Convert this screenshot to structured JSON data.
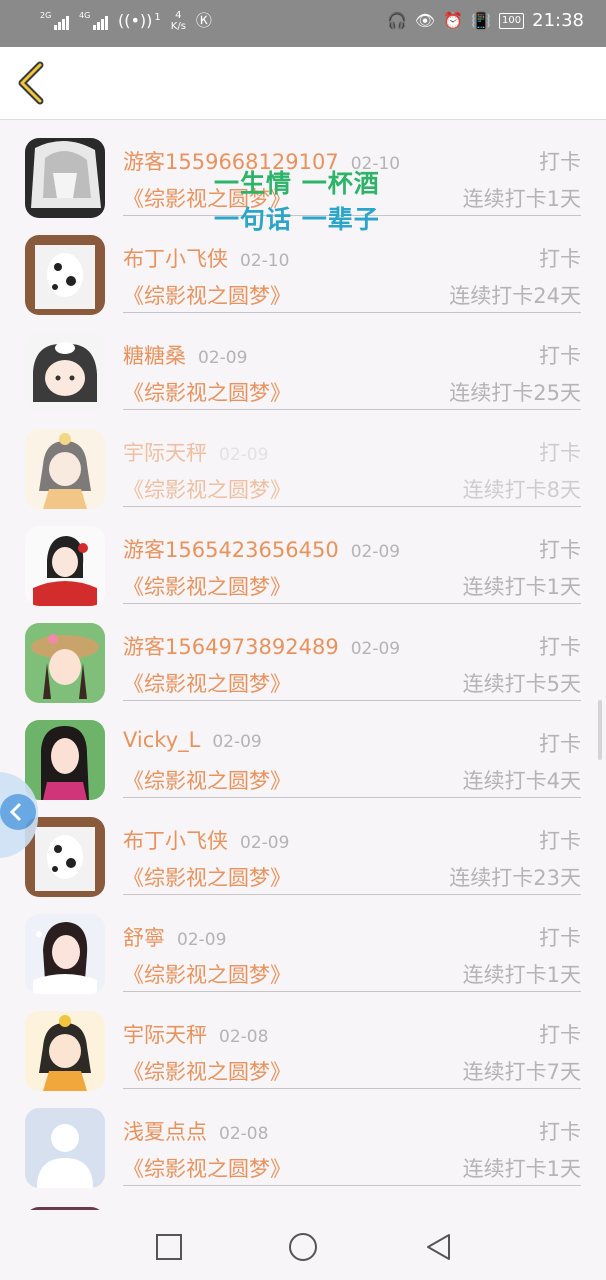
{
  "status_bar": {
    "sim1": "2G",
    "sim2": "4G",
    "data_count": "1",
    "speed_value": "4",
    "speed_unit": "K/s",
    "battery": "100",
    "time": "21:38"
  },
  "header": {
    "back_icon": "chevron-left-icon"
  },
  "overlay_text": {
    "line1": "一生情 一杯酒",
    "line2": "一句话 一辈子"
  },
  "entries": [
    {
      "user": "游客1559668129107",
      "date": "02-10",
      "action": "打卡",
      "book": "《综影视之圆梦》",
      "streak": "连续打卡1天"
    },
    {
      "user": "布丁小飞侠",
      "date": "02-10",
      "action": "打卡",
      "book": "《综影视之圆梦》",
      "streak": "连续打卡24天"
    },
    {
      "user": "糖糖桑",
      "date": "02-09",
      "action": "打卡",
      "book": "《综影视之圆梦》",
      "streak": "连续打卡25天"
    },
    {
      "user": "宇际天秤",
      "date": "02-09",
      "action": "打卡",
      "book": "《综影视之圆梦》",
      "streak": "连续打卡8天"
    },
    {
      "user": "游客1565423656450",
      "date": "02-09",
      "action": "打卡",
      "book": "《综影视之圆梦》",
      "streak": "连续打卡1天"
    },
    {
      "user": "游客1564973892489",
      "date": "02-09",
      "action": "打卡",
      "book": "《综影视之圆梦》",
      "streak": "连续打卡5天"
    },
    {
      "user": "Vicky_L",
      "date": "02-09",
      "action": "打卡",
      "book": "《综影视之圆梦》",
      "streak": "连续打卡4天"
    },
    {
      "user": "布丁小飞侠",
      "date": "02-09",
      "action": "打卡",
      "book": "《综影视之圆梦》",
      "streak": "连续打卡23天"
    },
    {
      "user": "舒寧",
      "date": "02-09",
      "action": "打卡",
      "book": "《综影视之圆梦》",
      "streak": "连续打卡1天"
    },
    {
      "user": "宇际天秤",
      "date": "02-08",
      "action": "打卡",
      "book": "《综影视之圆梦》",
      "streak": "连续打卡7天"
    },
    {
      "user": "浅夏点点",
      "date": "02-08",
      "action": "打卡",
      "book": "《综影视之圆梦》",
      "streak": "连续打卡1天"
    }
  ],
  "colors": {
    "accent": "#e8935e",
    "muted": "#b4b4b4",
    "overlay_green": "#2eb36a",
    "overlay_blue": "#2ba5c9"
  },
  "nav_bar": {
    "recent_icon": "square-icon",
    "home_icon": "circle-icon",
    "back_icon": "triangle-back-icon"
  }
}
